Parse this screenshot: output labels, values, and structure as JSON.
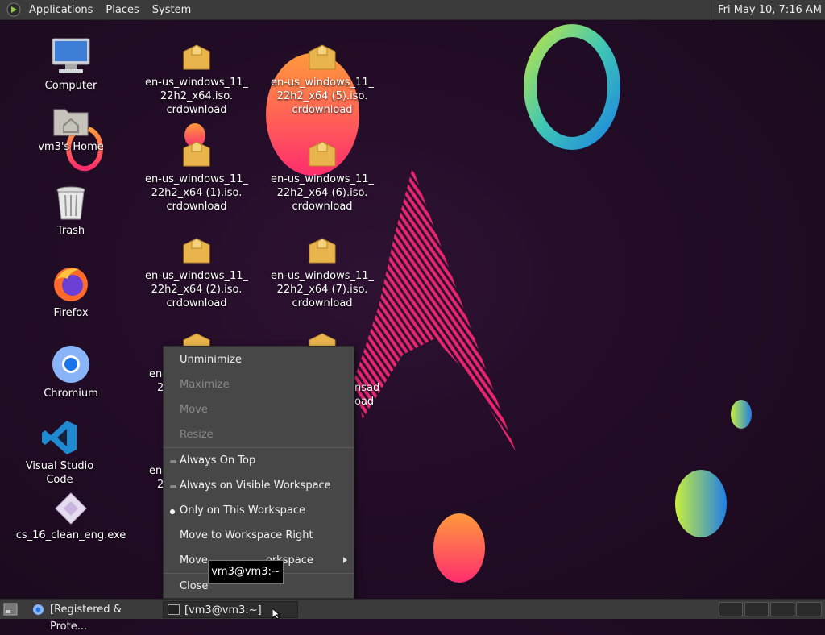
{
  "top_panel": {
    "menus": [
      "Applications",
      "Places",
      "System"
    ],
    "clock": "Fri May 10,  7:16 AM"
  },
  "desktop_icons": [
    {
      "label": "Computer",
      "icon": "computer-icon"
    },
    {
      "label": "vm3's Home",
      "icon": "home-folder-icon"
    },
    {
      "label": "Trash",
      "icon": "trash-icon"
    },
    {
      "label": "Firefox",
      "icon": "firefox-icon"
    },
    {
      "label": "Chromium",
      "icon": "chromium-icon"
    },
    {
      "label": "Visual Studio Code",
      "icon": "vscode-icon"
    },
    {
      "label": "cs_16_clean_eng.exe",
      "icon": "exe-file-icon"
    }
  ],
  "files": [
    {
      "lines": [
        "en-us_windows_11_",
        "22h2_x64.iso.",
        "crdownload"
      ]
    },
    {
      "lines": [
        "en-us_windows_11_",
        "22h2_x64 (5).iso.",
        "crdownload"
      ]
    },
    {
      "lines": [
        "en-us_windows_11_",
        "22h2_x64 (1).iso.",
        "crdownload"
      ]
    },
    {
      "lines": [
        "en-us_windows_11_",
        "22h2_x64 (6).iso.",
        "crdownload"
      ]
    },
    {
      "lines": [
        "en-us_windows_11_",
        "22h2_x64 (2).iso.",
        "crdownload"
      ]
    },
    {
      "lines": [
        "en-us_windows_11_",
        "22h2_x64 (7).iso.",
        "crdownload"
      ]
    }
  ],
  "partial_labels": {
    "left_a": "en-",
    "left_a2": "2",
    "left_b": "en-",
    "left_b2": "2",
    "right_a": "nsad",
    "right_a2": "oad"
  },
  "context_menu": {
    "items": [
      {
        "label": "Unminimize",
        "enabled": true
      },
      {
        "label": "Maximize",
        "enabled": false
      },
      {
        "label": "Move",
        "enabled": false
      },
      {
        "label": "Resize",
        "enabled": false
      },
      {
        "label": "Always On Top",
        "enabled": true,
        "marker": "off"
      },
      {
        "label": "Always on Visible Workspace",
        "enabled": true,
        "marker": "off"
      },
      {
        "label": "Only on This Workspace",
        "enabled": true,
        "marker": "on"
      },
      {
        "label": "Move to Workspace Right",
        "enabled": true
      },
      {
        "label_a": "Move",
        "label_b": "orkspace",
        "enabled": true,
        "submenu": true
      },
      {
        "label": "Close",
        "enabled": true
      }
    ]
  },
  "tooltip": "vm3@vm3:~",
  "taskbar": {
    "tasks": [
      "[Registered & Prote...",
      "[vm3@vm3:~]"
    ]
  },
  "colors": {
    "panel": "#3b3b3b",
    "menu_bg": "#474747",
    "desktop_bg": "#220c26",
    "accent_pink": "#e8246e"
  }
}
